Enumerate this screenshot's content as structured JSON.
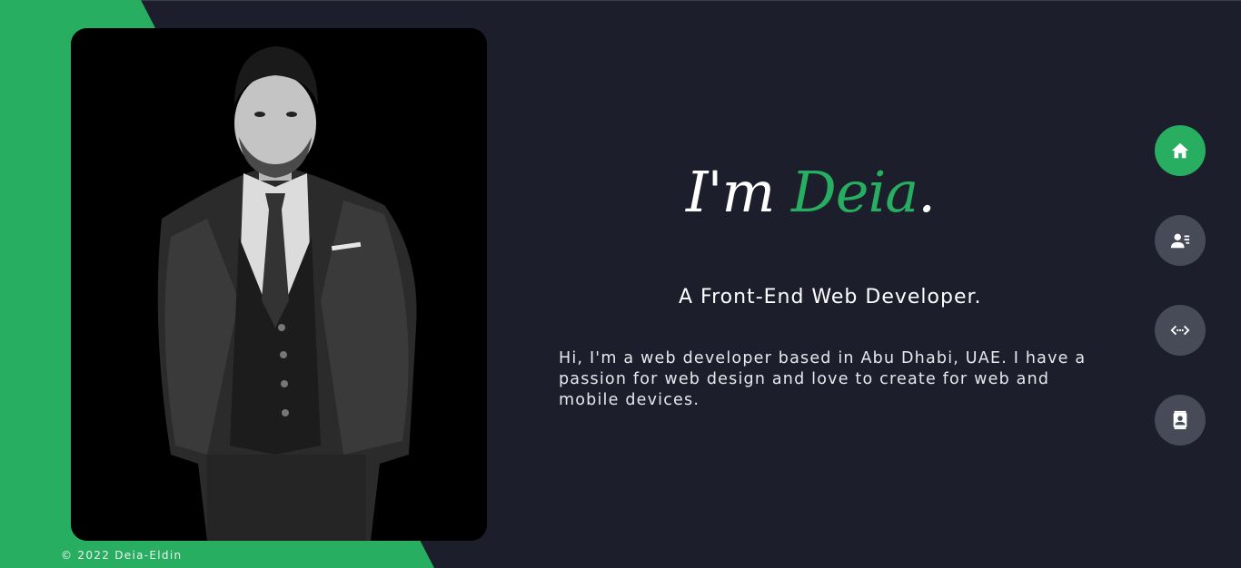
{
  "hero": {
    "intro": "I'm",
    "name": "Deia",
    "dot": "."
  },
  "subtitle": "A Front-End Web Developer.",
  "bio": "Hi, I'm a web developer based in Abu Dhabi, UAE. I have a passion for web design and love to create for web and mobile devices.",
  "footer": "© 2022 Deia-Eldin",
  "nav": [
    {
      "icon": "home-icon",
      "active": true
    },
    {
      "icon": "about-icon",
      "active": false
    },
    {
      "icon": "code-icon",
      "active": false
    },
    {
      "icon": "contact-icon",
      "active": false
    }
  ],
  "colors": {
    "accent": "#27ae60",
    "background": "#1c1e2c",
    "nav_inactive": "#474b58"
  }
}
